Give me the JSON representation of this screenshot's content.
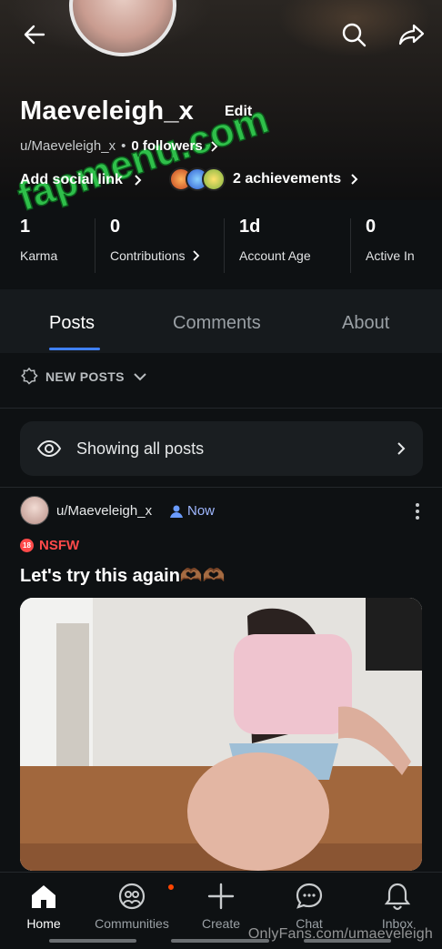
{
  "header": {
    "back_icon": "arrow-left-icon",
    "search_icon": "search-icon",
    "share_icon": "share-icon",
    "watermark_text": "fapmenu.com"
  },
  "profile": {
    "display_name": "Maeveleigh_x",
    "edit_label": "Edit",
    "handle": "u/Maeveleigh_x",
    "bullet": "•",
    "followers": "0 followers",
    "social_link_label": "Add social link",
    "achievements_label": "2 achievements"
  },
  "stats": [
    {
      "value": "1",
      "label": "Karma"
    },
    {
      "value": "0",
      "label": "Contributions"
    },
    {
      "value": "1d",
      "label": "Account Age"
    },
    {
      "value": "0",
      "label": "Active In"
    }
  ],
  "tabs": [
    {
      "label": "Posts",
      "active": true
    },
    {
      "label": "Comments",
      "active": false
    },
    {
      "label": "About",
      "active": false
    }
  ],
  "sort": {
    "label": "NEW POSTS"
  },
  "filter": {
    "label": "Showing all posts"
  },
  "post": {
    "author": "u/Maeveleigh_x",
    "time": "Now",
    "nsfw_label": "NSFW",
    "nsfw_icon_text": "18",
    "title": "Let's try this again🫶🏾🫶🏾"
  },
  "bottom_nav": [
    {
      "label": "Home",
      "icon": "home-icon",
      "active": true
    },
    {
      "label": "Communities",
      "icon": "communities-icon",
      "active": false
    },
    {
      "label": "Create",
      "icon": "plus-icon",
      "active": false
    },
    {
      "label": "Chat",
      "icon": "chat-icon",
      "active": false
    },
    {
      "label": "Inbox",
      "icon": "bell-icon",
      "active": false
    }
  ],
  "footer_watermark": "OnlyFans.com/umaeveleigh",
  "colors": {
    "background": "#0e1113",
    "accent": "#3f80ff",
    "nsfw": "#ff4a4a",
    "notification": "#ff4500"
  }
}
